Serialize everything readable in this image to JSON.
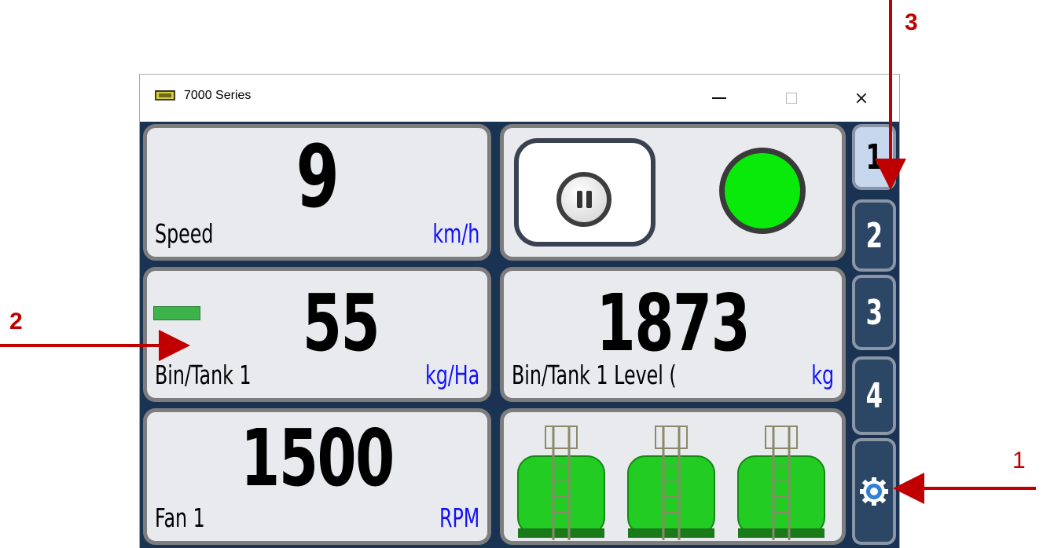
{
  "window": {
    "title": "7000 Series",
    "icon": "device-icon",
    "controls": {
      "minimize": "minimize",
      "maximize": "maximize",
      "close": "×"
    }
  },
  "panels": {
    "speed": {
      "value": "9",
      "label": "Speed",
      "unit": "km/h"
    },
    "control": {
      "pause_icon": "pause-icon",
      "status_color": "#0aea0a"
    },
    "rate": {
      "value": "55",
      "label": "Bin/Tank 1",
      "unit": "kg/Ha",
      "indicator_color": "#3cb44b"
    },
    "level": {
      "value": "1873",
      "label": "Bin/Tank 1 Level (",
      "unit": "kg"
    },
    "fan": {
      "value": "1500",
      "label": "Fan 1",
      "unit": "RPM"
    },
    "tanks": {
      "count": 3,
      "fill_color": "#22cc22"
    }
  },
  "tabs": [
    {
      "label": "1",
      "active": true
    },
    {
      "label": "2",
      "active": false
    },
    {
      "label": "3",
      "active": false
    },
    {
      "label": "4",
      "active": false
    }
  ],
  "settings_tab": {
    "icon": "gear-icon"
  },
  "annotations": {
    "a1": "1",
    "a2": "2",
    "a3": "3"
  },
  "colors": {
    "accent_red": "#c00000",
    "unit_blue": "#1010ff",
    "background": "#1b3352"
  }
}
